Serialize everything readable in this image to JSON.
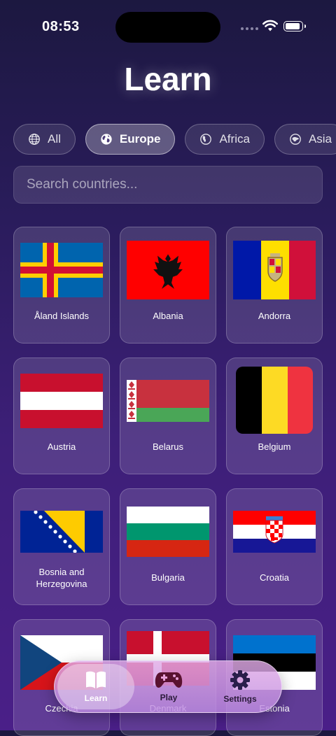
{
  "status": {
    "time": "08:53"
  },
  "title": "Learn",
  "filters": [
    {
      "label": "All",
      "icon": "globe-icon",
      "active": false
    },
    {
      "label": "Europe",
      "icon": "globe-europe-icon",
      "active": true
    },
    {
      "label": "Africa",
      "icon": "globe-africa-icon",
      "active": false
    },
    {
      "label": "Asia",
      "icon": "globe-asia-icon",
      "active": false
    }
  ],
  "search": {
    "placeholder": "Search countries...",
    "value": ""
  },
  "countries": [
    {
      "name": "Åland Islands",
      "flag": "aland"
    },
    {
      "name": "Albania",
      "flag": "albania"
    },
    {
      "name": "Andorra",
      "flag": "andorra"
    },
    {
      "name": "Austria",
      "flag": "austria"
    },
    {
      "name": "Belarus",
      "flag": "belarus"
    },
    {
      "name": "Belgium",
      "flag": "belgium"
    },
    {
      "name": "Bosnia and Herzegovina",
      "flag": "bosnia"
    },
    {
      "name": "Bulgaria",
      "flag": "bulgaria"
    },
    {
      "name": "Croatia",
      "flag": "croatia"
    },
    {
      "name": "Czechia",
      "flag": "czechia"
    },
    {
      "name": "Denmark",
      "flag": "denmark"
    },
    {
      "name": "Estonia",
      "flag": "estonia"
    }
  ],
  "tabbar": {
    "learn": {
      "label": "Learn",
      "icon": "book-icon",
      "active": true
    },
    "play": {
      "label": "Play",
      "icon": "gamepad-icon",
      "active": false
    },
    "settings": {
      "label": "Settings",
      "icon": "gear-icon",
      "active": false
    }
  },
  "colors": {
    "accent": "#4a1f88",
    "tab_active": "#ffffff",
    "tab_inactive": "#2a1a3a"
  }
}
